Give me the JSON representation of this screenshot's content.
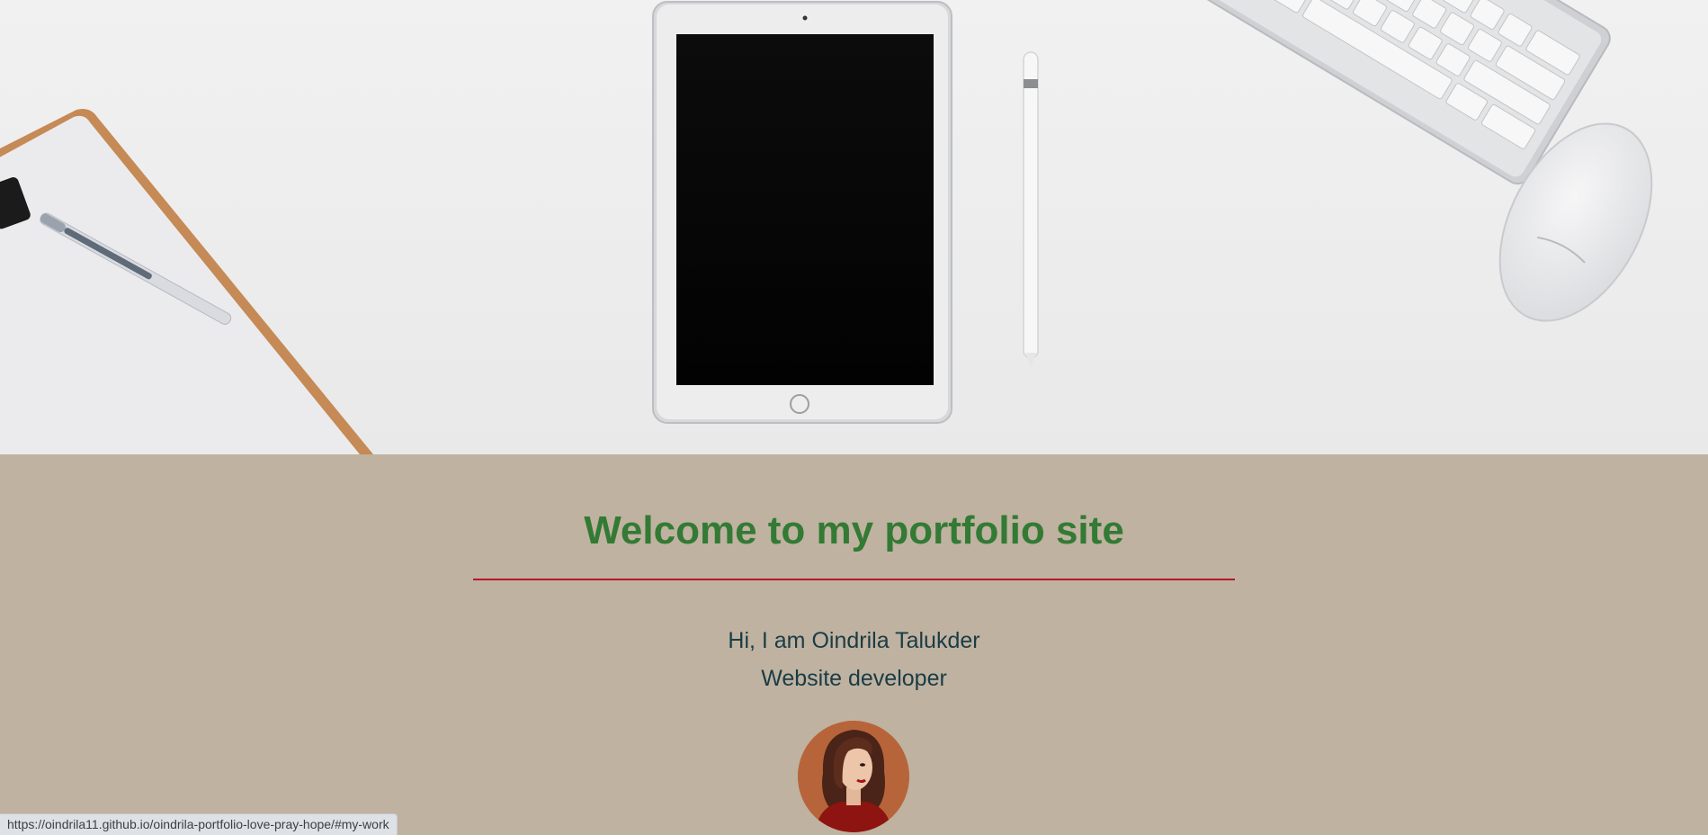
{
  "hero": {
    "image": "desk-flatlay-photo",
    "items": [
      "clipboard",
      "pen",
      "tablet",
      "stylus",
      "keyboard",
      "mouse"
    ]
  },
  "welcome": {
    "title": "Welcome to my portfolio site",
    "greeting": "Hi, I am Oindrila Talukder",
    "role": "Website developer"
  },
  "avatar": {
    "icon": "woman-portrait-avatar"
  },
  "status_bar": {
    "url": "https://oindrila11.github.io/oindrila-portfolio-love-pray-hope/#my-work"
  },
  "colors": {
    "content_background": "#bfb2a0",
    "title": "#337a34",
    "rule": "#b2182b",
    "intro_text": "#1a3c46"
  }
}
